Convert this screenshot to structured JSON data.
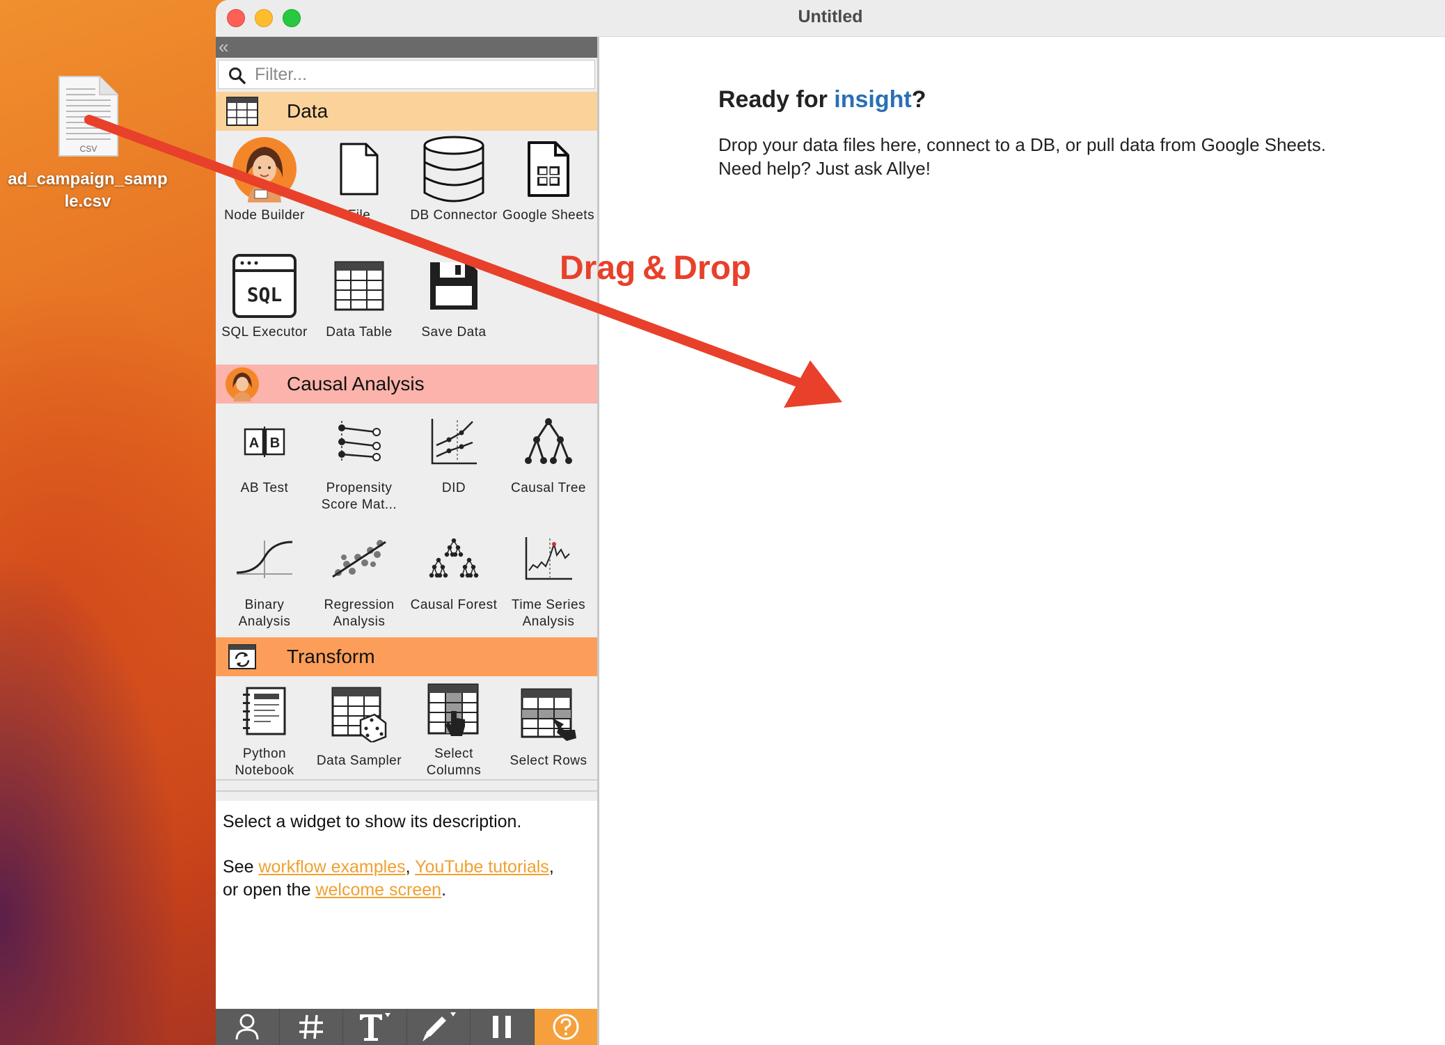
{
  "desktop": {
    "file_name": "ad_campaign_sample.csv",
    "file_type": "CSV"
  },
  "window": {
    "title": "Untitled"
  },
  "panel": {
    "collapse_glyph": "«",
    "filter_placeholder": "Filter...",
    "categories": {
      "data": {
        "title": "Data",
        "tiles": [
          "Node Builder",
          "File",
          "DB Connector",
          "Google Sheets",
          "SQL Executor",
          "Data Table",
          "Save Data"
        ]
      },
      "causal": {
        "title": "Causal Analysis",
        "tiles": [
          "AB Test",
          "Propensity Score Mat...",
          "DID",
          "Causal Tree",
          "Binary Analysis",
          "Regression Analysis",
          "Causal Forest",
          "Time Series Analysis"
        ]
      },
      "transform": {
        "title": "Transform",
        "tiles": [
          "Python Notebook",
          "Data Sampler",
          "Select Columns",
          "Select Rows"
        ]
      }
    },
    "sql_icon_text": "SQL",
    "ab_icon_a": "A",
    "ab_icon_b": "B",
    "description": {
      "line1": "Select a widget to show its description.",
      "see": "See ",
      "link_workflow": "workflow examples",
      "comma1": ", ",
      "link_youtube": "YouTube tutorials",
      "comma2": ",",
      "or_open": "or open the ",
      "link_welcome": "welcome screen",
      "period": "."
    },
    "toolbar": [
      "user-icon",
      "grid-icon",
      "text-icon",
      "pen-icon",
      "pause-icon",
      "help-icon"
    ]
  },
  "canvas": {
    "ready_prefix": "Ready for ",
    "ready_accent": "insight",
    "ready_suffix": "?",
    "intro_line1": "Drop your data files here, connect to a DB, or pull data from Google Sheets.",
    "intro_line2": "Need help? Just ask Allye!"
  },
  "annotation": {
    "label": "Drag & Drop",
    "color": "#e8402a"
  },
  "colors": {
    "data_header": "#fbd29a",
    "causal_header": "#fbb3ab",
    "transform_header": "#fc9e59",
    "link": "#f0a030",
    "accent": "#2a6fb5"
  }
}
